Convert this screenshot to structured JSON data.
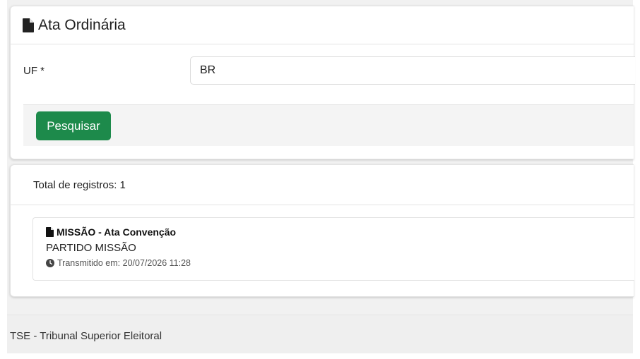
{
  "search_card": {
    "title": "Ata Ordinária",
    "title_icon": "file-icon",
    "uf_label": "UF *",
    "uf_value": "BR",
    "search_button": "Pesquisar"
  },
  "results": {
    "total_text": "Total de registros: 1",
    "items": [
      {
        "title": "MISSÃO - Ata Convenção",
        "party": "PARTIDO MISSÃO",
        "transmitted": "Transmitido em: 20/07/2026 11:28"
      }
    ]
  },
  "footer": {
    "text": "TSE - Tribunal Superior Eleitoral"
  },
  "colors": {
    "primary_button": "#1d8a4b",
    "background": "#f1f1f1"
  }
}
